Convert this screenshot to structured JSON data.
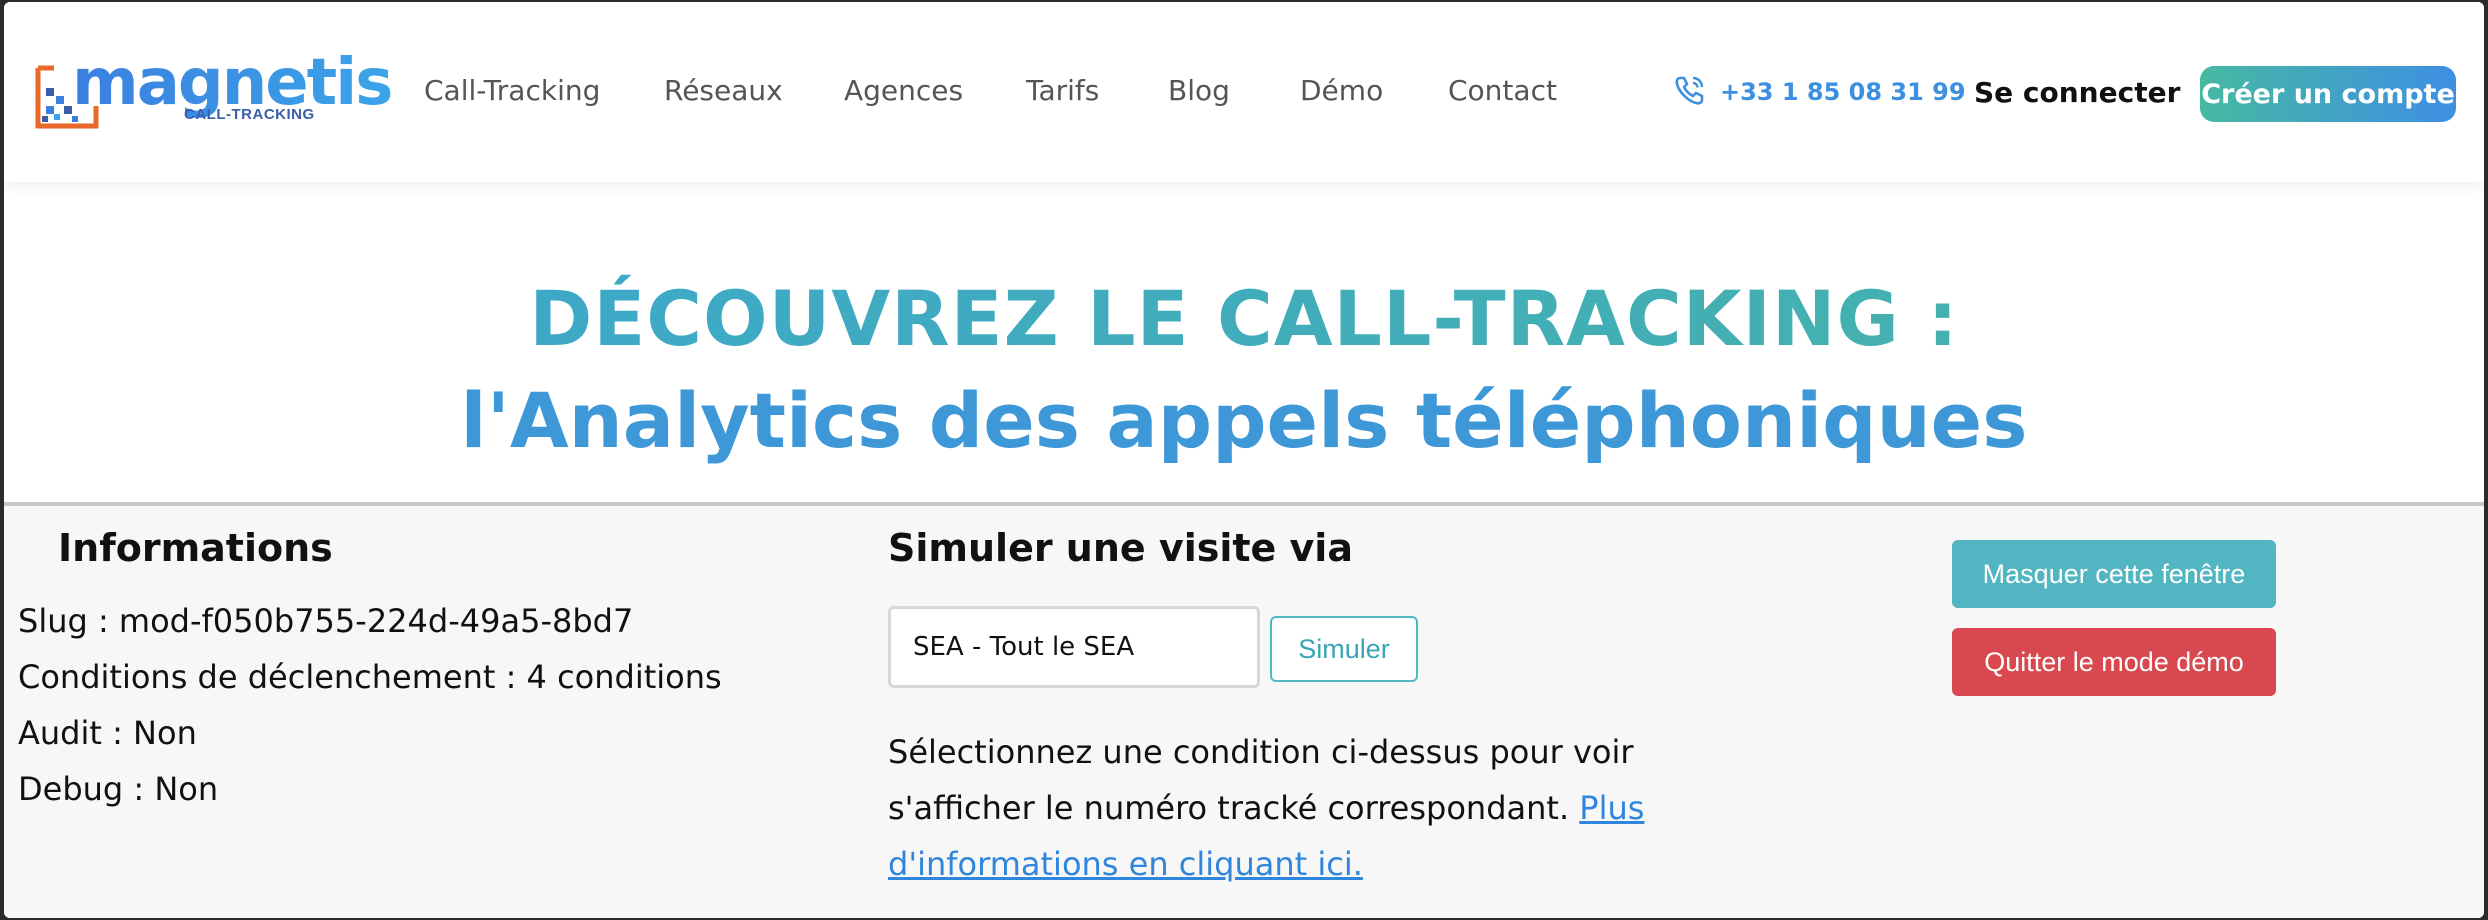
{
  "header": {
    "logo": {
      "name": "magnetis",
      "subtitle": "CALL-TRACKING"
    },
    "nav": [
      {
        "label": "Call-Tracking"
      },
      {
        "label": "Réseaux"
      },
      {
        "label": "Agences"
      },
      {
        "label": "Tarifs"
      },
      {
        "label": "Blog"
      },
      {
        "label": "Démo"
      },
      {
        "label": "Contact"
      }
    ],
    "phone": {
      "icon": "phone-icon",
      "number": "+33 1 85 08 31 99"
    },
    "login_label": "Se connecter",
    "signup_label": "Créer un compte"
  },
  "hero": {
    "line1": "DÉCOUVREZ LE CALL-TRACKING :",
    "line2": "l'Analytics des appels téléphoniques"
  },
  "demo_panel": {
    "info_title": "Informations",
    "info": {
      "slug": "Slug : mod-f050b755-224d-49a5-8bd7",
      "conditions": "Conditions de déclenchement : 4 conditions",
      "audit": "Audit : Non",
      "debug": "Debug : Non"
    },
    "simulate_title": "Simuler une visite via",
    "simulate_select_value": "SEA - Tout le SEA",
    "simulate_button": "Simuler",
    "simulate_text": "Sélectionnez une condition ci-dessus pour voir s'afficher le numéro tracké correspondant.",
    "simulate_link": "Plus d'informations en cliquant ici.",
    "hide_button": "Masquer cette fenêtre",
    "quit_button": "Quitter le mode démo"
  },
  "colors": {
    "brand_blue": "#3e8fe3",
    "brand_teal": "#46b9a2",
    "logo_orange": "#e8692a",
    "hide_button": "#52b5c2",
    "quit_button": "#d9474f"
  }
}
